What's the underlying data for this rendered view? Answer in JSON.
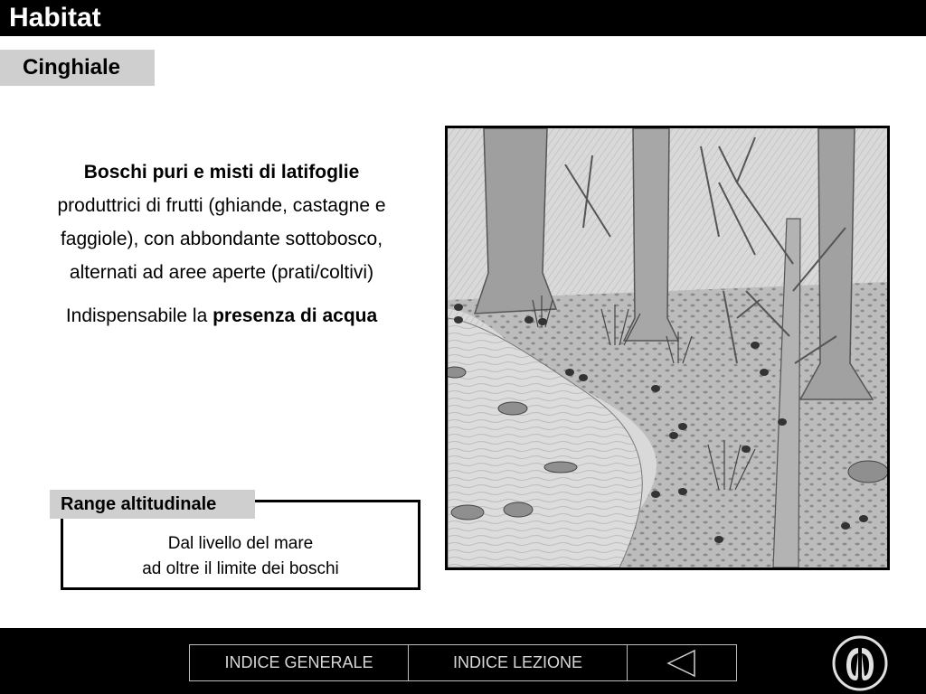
{
  "header": {
    "title": "Habitat"
  },
  "subtab": {
    "label": "Cinghiale"
  },
  "description": {
    "bold_intro": "Boschi puri e misti di latifoglie",
    "intro_rest": "produttrici di frutti (ghiande, castagne e faggiole), con abbondante sottobosco, alternati ad aree aperte (prati/coltivi)",
    "water_prefix": "Indispensabile la ",
    "water_bold": "presenza di acqua"
  },
  "range": {
    "label": "Range altitudinale",
    "line1": "Dal livello del mare",
    "line2": "ad oltre il limite dei boschi"
  },
  "nav": {
    "general_index": "INDICE GENERALE",
    "lesson_index": "INDICE LEZIONE",
    "back_icon": "left-triangle-icon"
  },
  "logo": {
    "icon": "hoofprint-icon"
  }
}
